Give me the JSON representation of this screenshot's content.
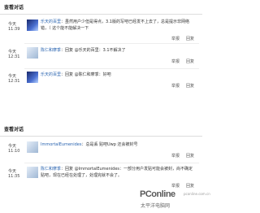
{
  "panel1": {
    "title": "查看对话",
    "entries": [
      {
        "date": "今天",
        "time": "11:39",
        "name": "乐天的百里",
        "text": "：虽然用户少但是得点，3.1版的写吧已经发不上去了，总是提示非网络错，（ 这个能不能解决一下",
        "reply": "举报",
        "respond": "回复"
      },
      {
        "date": "今天",
        "time": "12:31",
        "name": "陈仁和摩季",
        "text": "：回复 @乐天的百里：3.1不解决了",
        "reply": "举报",
        "respond": "回复"
      },
      {
        "date": "今天",
        "time": "12:31",
        "name": "乐天的百里",
        "text": "：回复 @陈仁和摩季：好吧",
        "reply": "举报",
        "respond": "回复"
      }
    ]
  },
  "panel2": {
    "title": "查看对话",
    "entries": [
      {
        "date": "今天",
        "time": "11:10",
        "name": "ImmortalEumenides",
        "text": "：总是丢 贴吧Uwp 还会被封号",
        "reply": "举报",
        "respond": "回复"
      },
      {
        "date": "今天",
        "time": "11:35",
        "name": "陈仁和摩季",
        "text": "：回复 @ImmortalEumenides：一部分用户发贴可能会被封，尚不确定贴吧，现在已经在处理了，处理完就不会了。",
        "reply": "举报",
        "respond": "回复"
      }
    ]
  },
  "watermark": {
    "brand": "PConline",
    "sub": "太平洋电脑网",
    "url": "pconline.com.cn"
  }
}
